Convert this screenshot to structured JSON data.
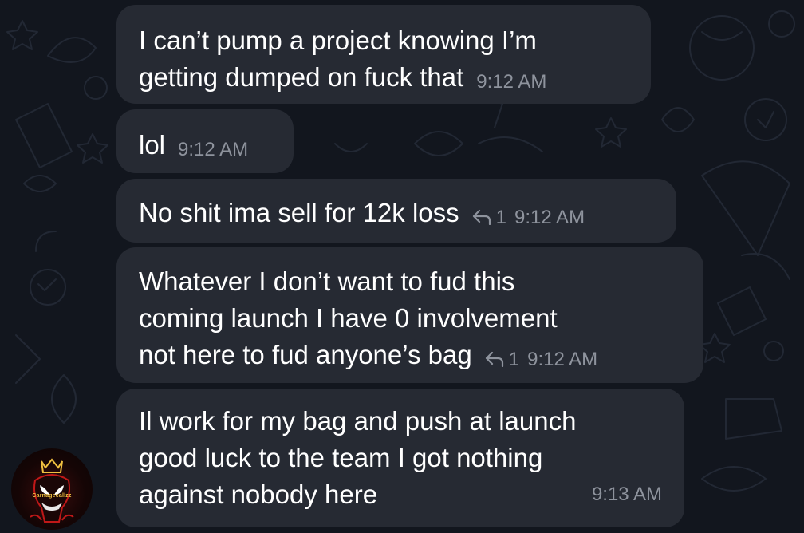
{
  "messages": [
    {
      "text": "I can’t pump a project knowing I’m\ngetting dumped on fuck that",
      "time": "9:12 AM",
      "replies": null
    },
    {
      "text": "lol",
      "time": "9:12 AM",
      "replies": null
    },
    {
      "text": "No shit ima sell for 12k loss",
      "time": "9:12 AM",
      "replies": "1"
    },
    {
      "text": "Whatever I don’t want to fud this\ncoming launch I have 0 involvement\nnot here to fud anyone’s bag",
      "time": "9:12 AM",
      "replies": "1"
    },
    {
      "text": "Il work for my bag and push at launch\ngood luck to the team I got nothing\nagainst nobody here",
      "time": "9:13 AM",
      "replies": null
    }
  ],
  "avatar": {
    "label": "Carnagecallzz"
  },
  "colors": {
    "background": "#12161e",
    "bubble": "#262a33",
    "text": "#ffffff",
    "meta": "#8e939d",
    "doodle": "#222834",
    "avatar_accent": "#f0c040"
  },
  "icons": {
    "reply": "reply-arrow-icon",
    "avatar": "avatar-icon"
  }
}
